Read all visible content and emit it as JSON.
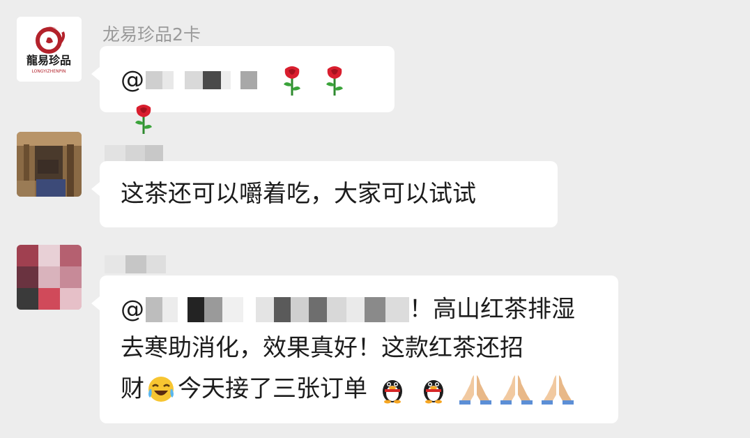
{
  "messages": [
    {
      "sender": "龙易珍品2卡",
      "avatar_text": "龍易珍品",
      "avatar_sub": "LONGYIZHENPIN",
      "mention_prefix": "@",
      "emoji": [
        "rose-icon",
        "rose-icon",
        "rose-icon"
      ]
    },
    {
      "sender": "",
      "text": "这茶还可以嚼着吃，大家可以试试"
    },
    {
      "sender": "",
      "mention_prefix": "@",
      "line1_tail": "！高山红茶排湿",
      "line2": "去寒助消化，效果真好！这款红茶还招",
      "line3_a": "财",
      "line3_b": "今天接了三张订单",
      "emoji_line3": [
        "laughing-crying-face-icon",
        "penguin-icon",
        "penguin-icon",
        "praying-hands-icon",
        "praying-hands-icon",
        "praying-hands-icon"
      ]
    }
  ],
  "colors": {
    "background": "#ededed",
    "bubble": "#ffffff",
    "sender_name": "#9a9a9a",
    "text": "#1c1c1c",
    "logo_red": "#b3222b"
  }
}
